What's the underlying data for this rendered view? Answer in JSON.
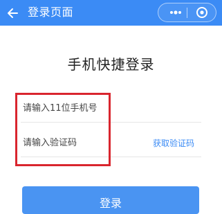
{
  "nav_bar": {
    "title": "登录页面",
    "back_icon": "arrow-left-icon",
    "more_icon": "more-dots-icon",
    "close_icon": "target-close-icon",
    "background_color": "#3b8bf5"
  },
  "main": {
    "heading": "手机快捷登录",
    "phone_field": {
      "placeholder": "请输入11位手机号",
      "value": ""
    },
    "code_field": {
      "placeholder": "请输入验证码",
      "value": ""
    },
    "get_code_label": "获取验证码",
    "login_label": "登录"
  },
  "annotation": {
    "highlight_color": "#d9252e"
  },
  "accent_color": "#3b8bf5"
}
